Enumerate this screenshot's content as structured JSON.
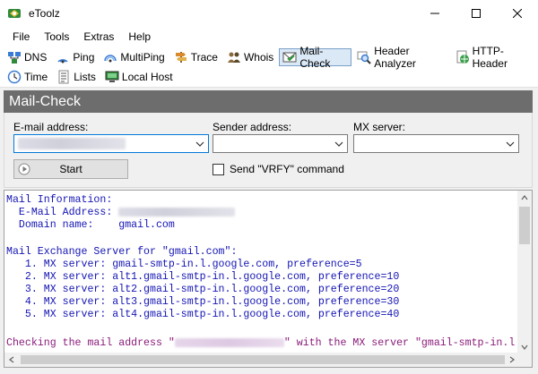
{
  "window": {
    "title": "eToolz"
  },
  "menu": [
    {
      "label": "File"
    },
    {
      "label": "Tools"
    },
    {
      "label": "Extras"
    },
    {
      "label": "Help"
    }
  ],
  "toolbar": {
    "row1": [
      {
        "label": "DNS",
        "icon": "network-icon",
        "active": false
      },
      {
        "label": "Ping",
        "icon": "ping-icon",
        "active": false
      },
      {
        "label": "MultiPing",
        "icon": "multiping-icon",
        "active": false
      },
      {
        "label": "Trace",
        "icon": "trace-icon",
        "active": false
      },
      {
        "label": "Whois",
        "icon": "people-icon",
        "active": false
      },
      {
        "label": "Mail-Check",
        "icon": "envelope-check-icon",
        "active": true
      },
      {
        "label": "Header Analyzer",
        "icon": "magnifier-icon",
        "active": false
      },
      {
        "label": "HTTP-Header",
        "icon": "globe-icon",
        "active": false
      }
    ],
    "row2": [
      {
        "label": "Time",
        "icon": "clock-icon",
        "active": false
      },
      {
        "label": "Lists",
        "icon": "list-icon",
        "active": false
      },
      {
        "label": "Local Host",
        "icon": "computer-icon",
        "active": false
      }
    ]
  },
  "panel": {
    "title": "Mail-Check"
  },
  "form": {
    "email_label": "E-mail address:",
    "sender_label": "Sender address:",
    "mx_label": "MX server:",
    "start_label": "Start",
    "vrfy_label": "Send \"VRFY\" command",
    "vrfy_checked": false
  },
  "output": {
    "l1": "Mail Information:",
    "l2": "  E-Mail Address: ",
    "l3": "  Domain name:    gmail.com",
    "l4": "Mail Exchange Server for \"gmail.com\":",
    "l5": "   1. MX server: gmail-smtp-in.l.google.com, preference=5",
    "l6": "   2. MX server: alt1.gmail-smtp-in.l.google.com, preference=10",
    "l7": "   3. MX server: alt2.gmail-smtp-in.l.google.com, preference=20",
    "l8": "   4. MX server: alt3.gmail-smtp-in.l.google.com, preference=30",
    "l9": "   5. MX server: alt4.gmail-smtp-in.l.google.com, preference=40",
    "l10a": "Checking the mail address \"",
    "l10b": "\" with the MX server \"gmail-smtp-in.l.go"
  },
  "colors": {
    "panel_header": "#6d6d6d",
    "output_blue": "#1414b4",
    "output_purple": "#8a1a7a",
    "active_tool": "#dbe8f6"
  }
}
